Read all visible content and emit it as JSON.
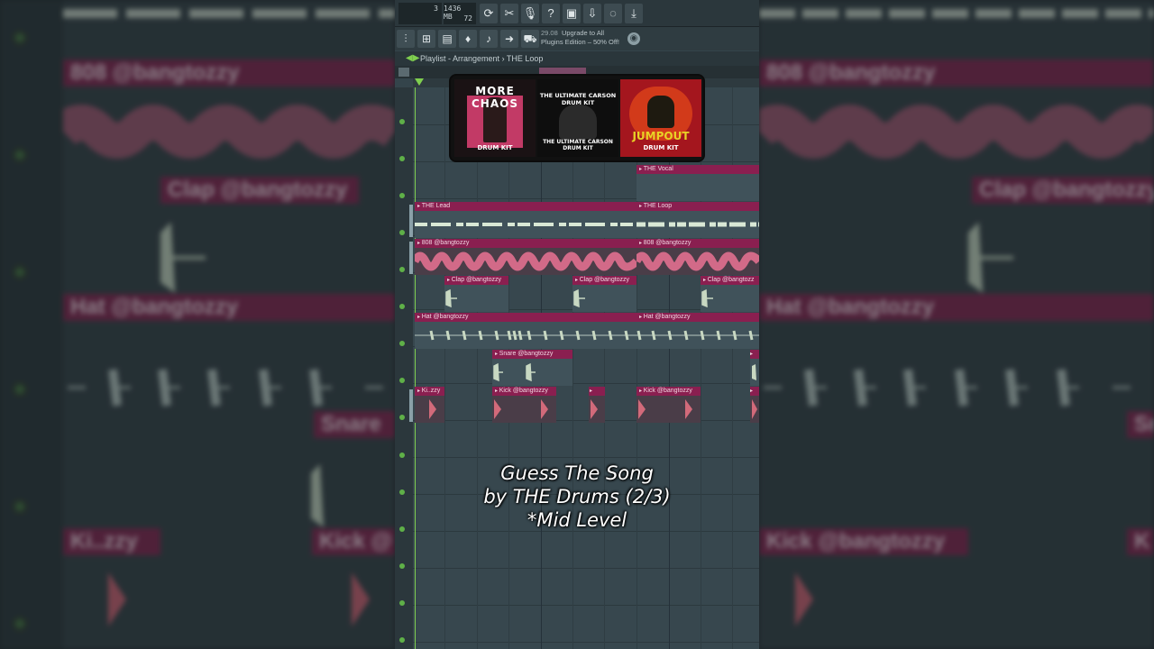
{
  "app": {
    "cpu": {
      "memory": "1436 MB",
      "polyphony": "3",
      "value2": "72"
    },
    "toolbar_icons": [
      "refresh-icon",
      "scissors-icon",
      "microphone-icon",
      "help-icon",
      "save-icon",
      "download-project-icon",
      "chat-icon",
      "download-icon"
    ],
    "secondary_icons": [
      "mixer-icon",
      "channel-rack-icon",
      "file-icon",
      "plugin-icon",
      "piano-roll-icon",
      "browser-icon",
      "shop-icon"
    ],
    "promo": {
      "time": "29.08",
      "line1": "Upgrade to All",
      "line2": "Plugins Edition – 50% Off!"
    }
  },
  "playlist": {
    "title": "Playlist - Arrangement",
    "separator": "›",
    "pattern": "THE Loop"
  },
  "covers": [
    {
      "title": "MORE CHAOS",
      "subtitle": "DRUM KIT",
      "color": "#c23a66"
    },
    {
      "title": "THE ULTIMATE CARSON DRUM KIT",
      "subtitle": "THE ULTIMATE CARSON DRUM KIT",
      "color": "#e8e8e8"
    },
    {
      "title": "JUMPOUT",
      "subtitle": "DRUM KIT",
      "color": "#e8d226"
    }
  ],
  "clips": {
    "vocal": "THE Vocal",
    "lead": "THE Lead",
    "loop": "THE Loop",
    "bass1": "808 @bangtozzy",
    "bass2": "808 @bangtozzy",
    "clap1": "Clap @bangtozzy",
    "clap2": "Clap @bangtozzy",
    "clap3": "Clap @bangtozz",
    "hat1": "Hat @bangtozzy",
    "hat2": "Hat @bangtozzy",
    "snare1": "Snare @bangtozzy",
    "kick1": "Ki..zzy",
    "kick2": "Kick @bangtozzy",
    "kick3": "Kick @bangtozzy"
  },
  "caption": {
    "line1": "Guess The Song",
    "line2": "by THE Drums (2/3)",
    "line3": "*Mid Level"
  },
  "background_left": {
    "clip_808": "808 @bangtozzy",
    "clip_clap": "Clap @bangtozzy",
    "clip_hat": "Hat @bangtozzy",
    "clip_snare": "Snare",
    "clip_kick_short": "Ki..zzy",
    "clip_kick": "Kick @"
  },
  "background_right": {
    "clip_808": "808 @bangtozzy",
    "clip_clap": "Clap @bangtozzy",
    "clip_hat": "Hat @bangtozzy",
    "clip_snare": "Sn",
    "clip_kick": "Kick @bangtozzy",
    "clip_kick2": "K"
  }
}
